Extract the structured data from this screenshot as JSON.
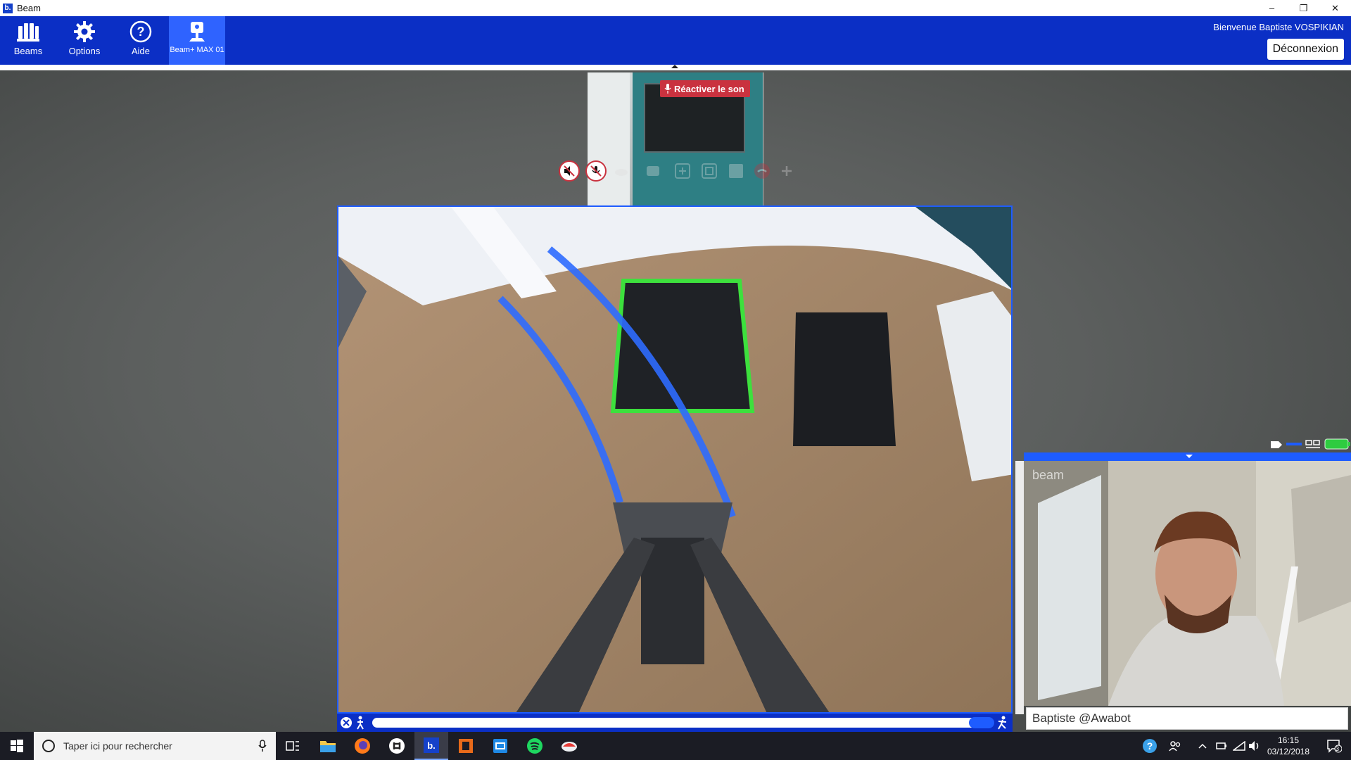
{
  "window": {
    "title": "Beam",
    "app_badge": "b.",
    "minimize": "–",
    "maximize": "❐",
    "close": "✕"
  },
  "toolbar": {
    "items": [
      {
        "label": "Beams",
        "icon": "beams-icon"
      },
      {
        "label": "Options",
        "icon": "gear-icon"
      },
      {
        "label": "Aide",
        "icon": "help-icon"
      },
      {
        "label": "Beam+ MAX 01",
        "icon": "robot-icon",
        "active": true
      }
    ],
    "welcome": "Bienvenue Baptiste VOSPIKIAN",
    "logout": "Déconnexion"
  },
  "session": {
    "unmute_label": "Réactiver le son",
    "controls": [
      {
        "icon": "speaker-muted-icon",
        "state": "on"
      },
      {
        "icon": "mic-muted-icon",
        "state": "on"
      },
      {
        "icon": "cloud-icon",
        "state": "faded"
      },
      {
        "icon": "share-icon",
        "state": "faded"
      },
      {
        "icon": "fullscreen-icon",
        "state": "faded"
      },
      {
        "icon": "window-icon",
        "state": "faded"
      },
      {
        "icon": "picture-icon",
        "state": "faded"
      },
      {
        "icon": "hangup-icon",
        "state": "faded"
      },
      {
        "icon": "plus-icon",
        "state": "faded"
      }
    ],
    "self_view_name": "Baptiste @Awabot",
    "watermark": "beam"
  },
  "taskbar": {
    "search_placeholder": "Taper ici pour rechercher",
    "time": "16:15",
    "date": "03/12/2018",
    "notification_count": "3"
  },
  "colors": {
    "toolbar_blue": "#0b2fc5",
    "accent_blue": "#1e5cff",
    "mute_red": "#c9323f",
    "battery_green": "#2ecc40"
  }
}
